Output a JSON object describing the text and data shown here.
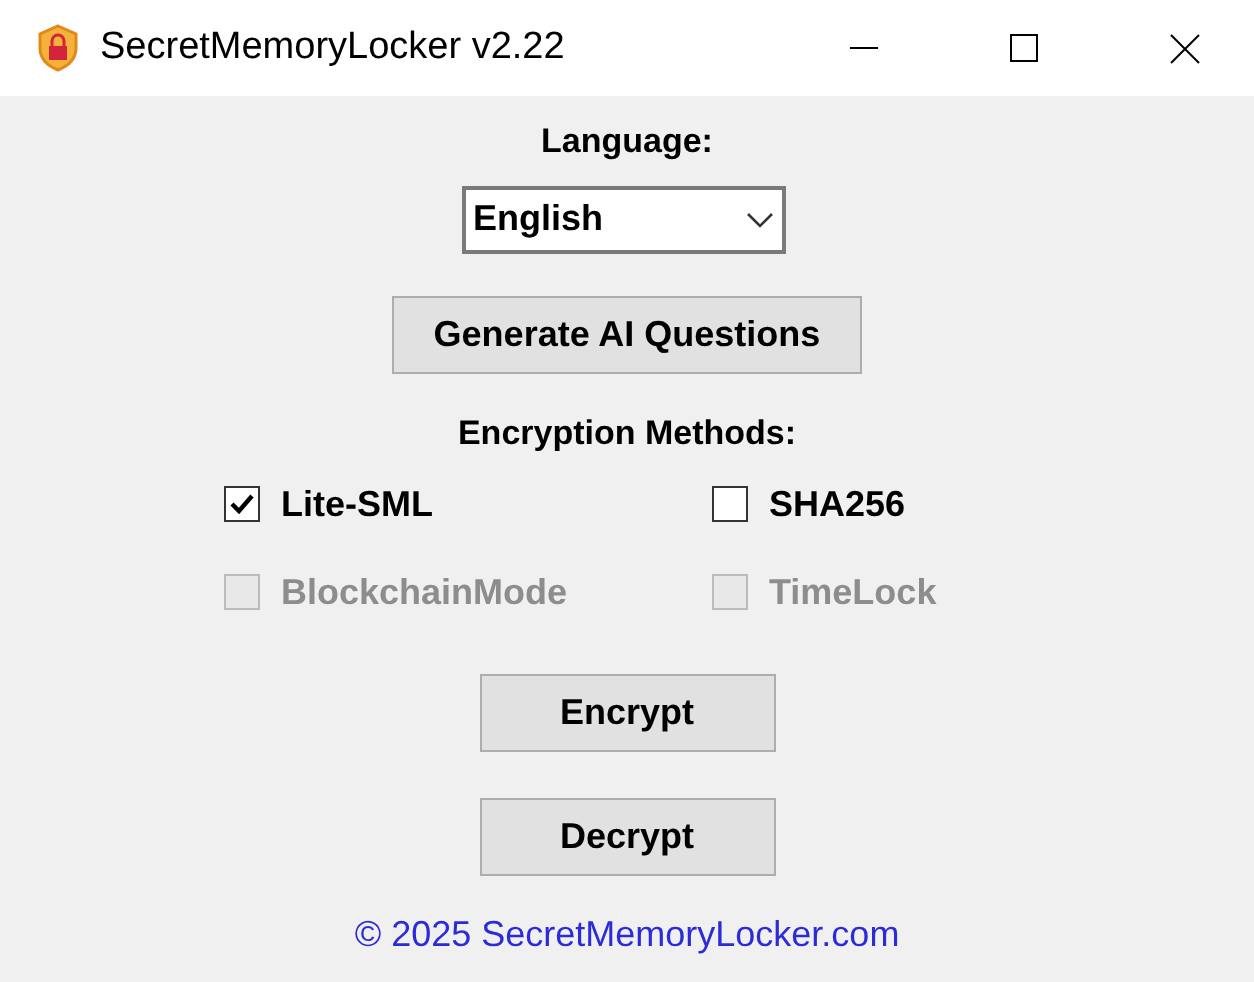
{
  "window": {
    "title": "SecretMemoryLocker v2.22"
  },
  "language": {
    "label": "Language:",
    "value": "English"
  },
  "generate_button": "Generate AI Questions",
  "methods": {
    "label": "Encryption Methods:",
    "options": [
      {
        "label": "Lite-SML",
        "checked": true,
        "disabled": false
      },
      {
        "label": "SHA256",
        "checked": false,
        "disabled": false
      },
      {
        "label": "BlockchainMode",
        "checked": false,
        "disabled": true
      },
      {
        "label": "TimeLock",
        "checked": false,
        "disabled": true
      }
    ]
  },
  "buttons": [
    "Encrypt",
    "Decrypt"
  ],
  "footer_link": "© 2025 SecretMemoryLocker.com"
}
